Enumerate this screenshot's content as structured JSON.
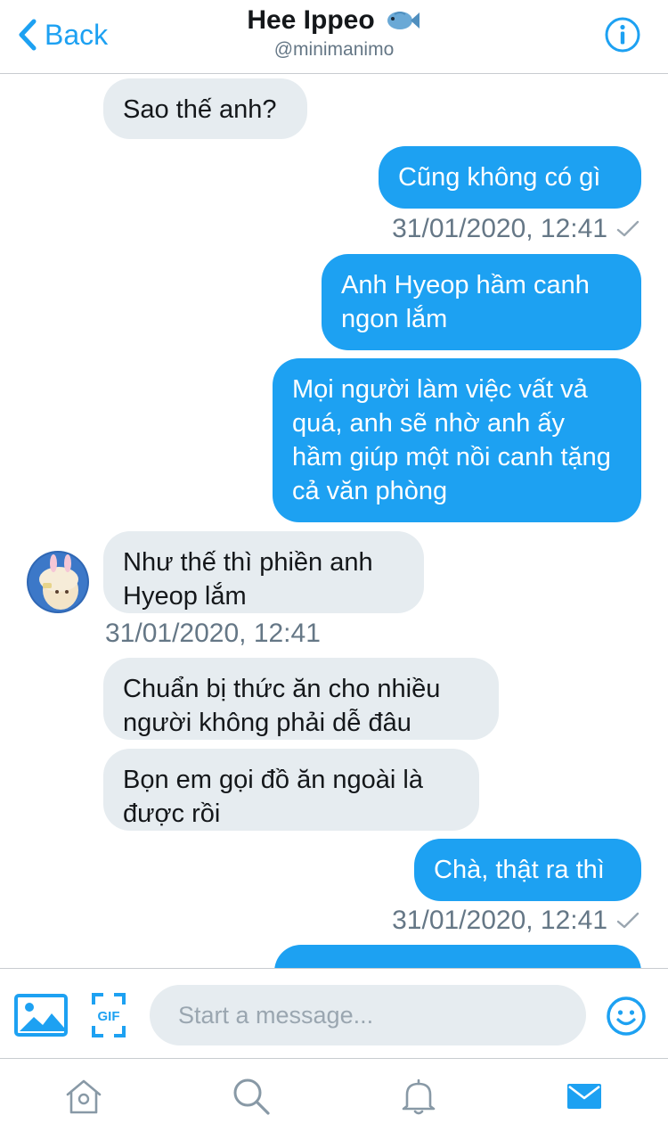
{
  "header": {
    "back_label": "Back",
    "title": "Hee Ippeo",
    "handle": "@minimanimo"
  },
  "messages": [
    {
      "text": "Sao thế anh?",
      "direction": "incoming"
    },
    {
      "text": "Cũng không có gì",
      "direction": "outgoing"
    },
    {
      "timestamp": "31/01/2020, 12:41",
      "read": true
    },
    {
      "text": "Anh Hyeop hầm canh ngon lắm",
      "direction": "outgoing"
    },
    {
      "text": "Mọi người làm việc vất vả quá, anh sẽ nhờ anh ấy hầm giúp một nồi canh tặng cả văn phòng",
      "direction": "outgoing"
    },
    {
      "text": "Như thế thì phiền anh Hyeop lắm",
      "direction": "incoming"
    },
    {
      "timestamp": "31/01/2020, 12:41",
      "read": false
    },
    {
      "text": "Chuẩn bị thức ăn cho nhiều người không phải dễ đâu",
      "direction": "incoming"
    },
    {
      "text": "Bọn em gọi đồ ăn ngoài là được rồi",
      "direction": "incoming"
    },
    {
      "text": "Chà, thật ra thì",
      "direction": "outgoing"
    },
    {
      "timestamp": "31/01/2020, 12:41",
      "read": true
    }
  ],
  "composer": {
    "placeholder": "Start a message...",
    "gif_label": "GIF"
  },
  "tabbar": {
    "items": [
      "home-icon",
      "search-icon",
      "notifications-icon",
      "messages-icon"
    ],
    "active": "messages-icon"
  },
  "colors": {
    "accent": "#1da1f2",
    "incoming_bubble": "#e6ecf0",
    "secondary_text": "#657786",
    "icon_gray": "#8899a6"
  }
}
